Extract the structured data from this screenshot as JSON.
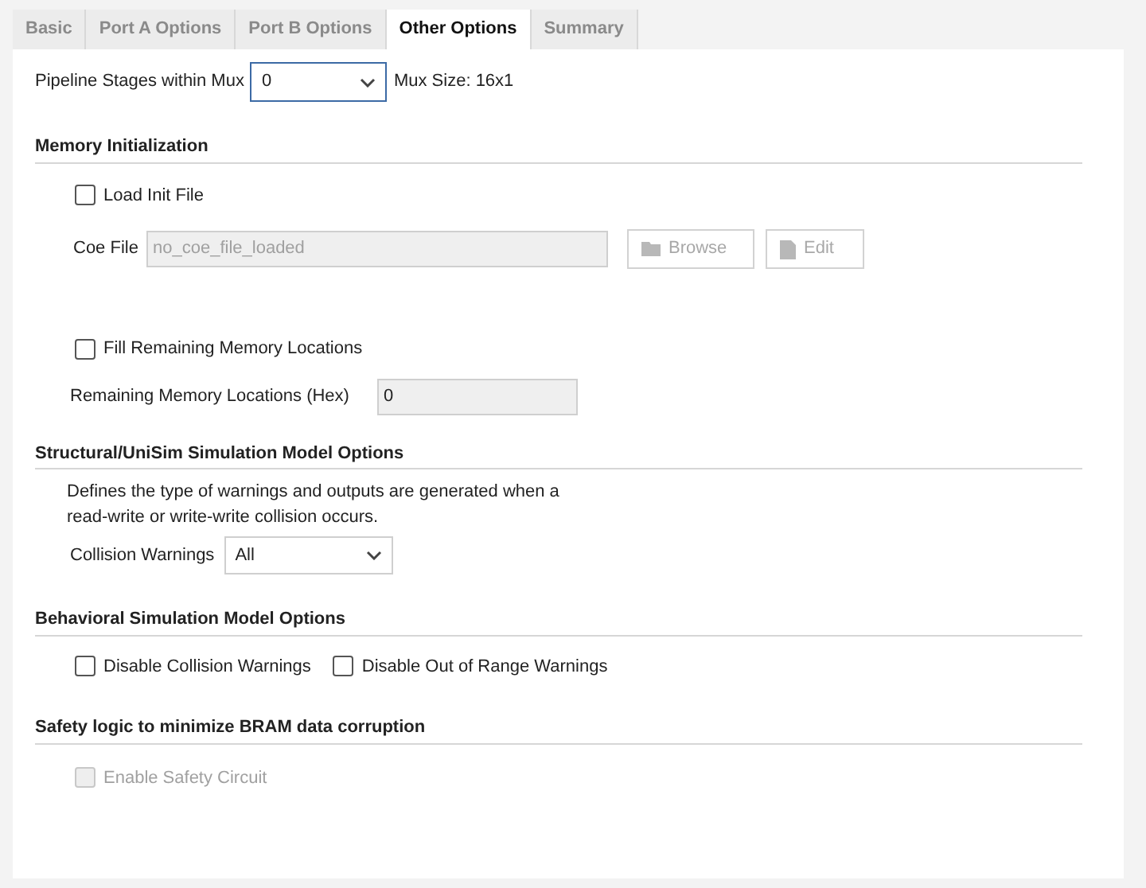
{
  "tabs": [
    {
      "label": "Basic",
      "selected": false
    },
    {
      "label": "Port A Options",
      "selected": false
    },
    {
      "label": "Port B Options",
      "selected": false
    },
    {
      "label": "Other Options",
      "selected": true
    },
    {
      "label": "Summary",
      "selected": false
    }
  ],
  "pipeline": {
    "label": "Pipeline Stages within Mux",
    "value": "0",
    "mux_size": "Mux Size: 16x1"
  },
  "memory_init": {
    "heading": "Memory Initialization",
    "load_init": {
      "label": "Load Init File",
      "checked": false
    },
    "coe_file": {
      "label": "Coe File",
      "value": "no_coe_file_loaded",
      "disabled": true
    },
    "buttons": [
      {
        "label": "Browse",
        "kind": "folder",
        "disabled": true
      },
      {
        "label": "Edit",
        "kind": "edit",
        "disabled": true
      }
    ],
    "fill_remaining": {
      "label": "Fill Remaining Memory Locations",
      "checked": false
    },
    "remaining": {
      "label": "Remaining Memory Locations (Hex)",
      "value": "0",
      "disabled": true
    }
  },
  "structural": {
    "heading": "Structural/UniSim Simulation Model Options",
    "description": "Defines the type of warnings and outputs are generated when a read-write or write-write collision occurs.",
    "collision": {
      "label": "Collision Warnings",
      "value": "All"
    }
  },
  "behavioral": {
    "heading": "Behavioral Simulation Model Options",
    "options": [
      {
        "label": "Disable Collision Warnings",
        "checked": false
      },
      {
        "label": "Disable Out of Range Warnings",
        "checked": false
      }
    ]
  },
  "safety": {
    "heading": "Safety logic to minimize BRAM data corruption",
    "option": {
      "label": "Enable Safety Circuit",
      "checked": false,
      "disabled": true
    }
  }
}
